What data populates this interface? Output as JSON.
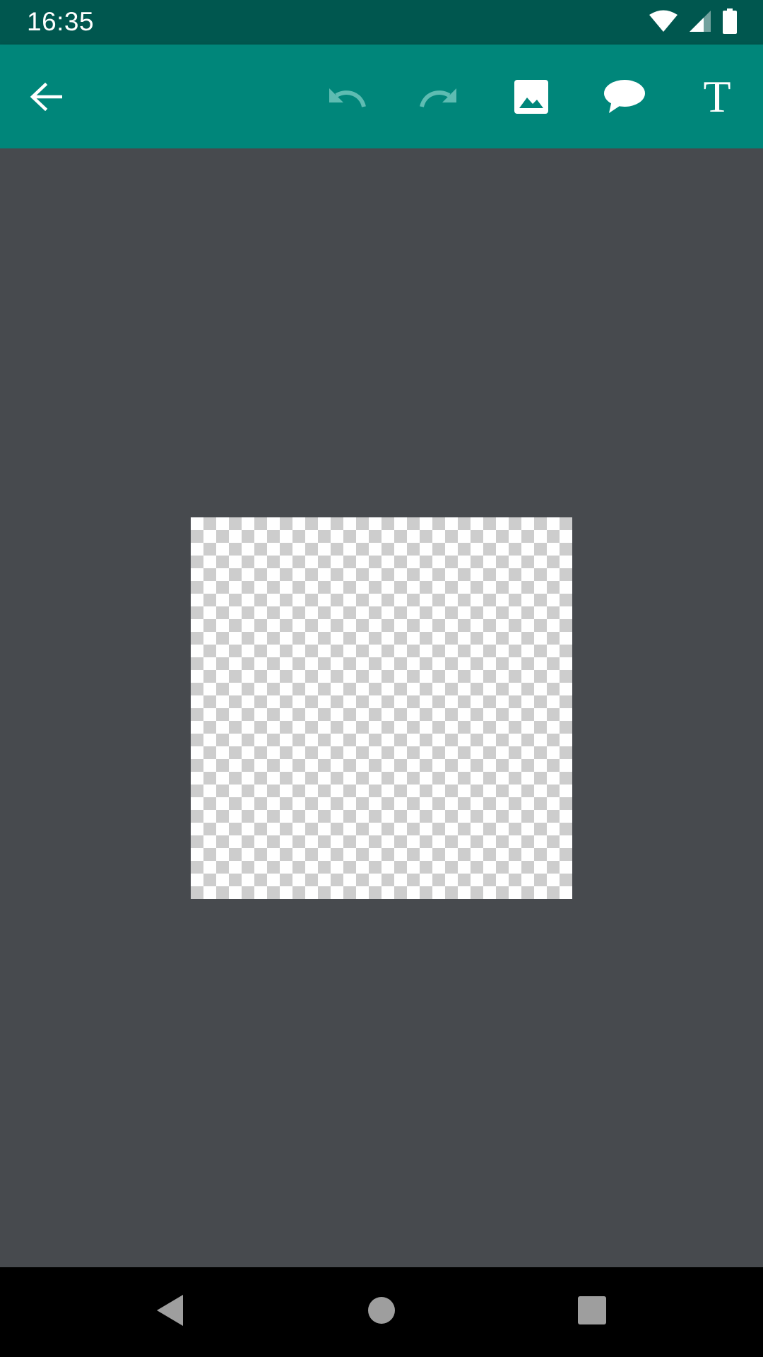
{
  "status_bar": {
    "time": "16:35",
    "background": "#00574f",
    "icons": [
      "wifi-icon",
      "cellular-signal-icon",
      "battery-icon"
    ]
  },
  "toolbar": {
    "background": "#00867a",
    "buttons": [
      {
        "name": "back",
        "icon": "arrow-left-icon",
        "enabled": true
      },
      {
        "name": "undo",
        "icon": "undo-icon",
        "enabled": false
      },
      {
        "name": "redo",
        "icon": "redo-icon",
        "enabled": false
      },
      {
        "name": "add-image",
        "icon": "image-icon",
        "enabled": true
      },
      {
        "name": "add-speech-bubble",
        "icon": "speech-bubble-icon",
        "enabled": true
      },
      {
        "name": "add-text",
        "icon": "text-icon",
        "label": "T",
        "enabled": true
      }
    ]
  },
  "canvas": {
    "background": "#474a4e",
    "image": "transparent-checkerboard"
  },
  "navigation_bar": {
    "buttons": [
      "back-triangle-icon",
      "home-circle-icon",
      "recents-square-icon"
    ]
  }
}
